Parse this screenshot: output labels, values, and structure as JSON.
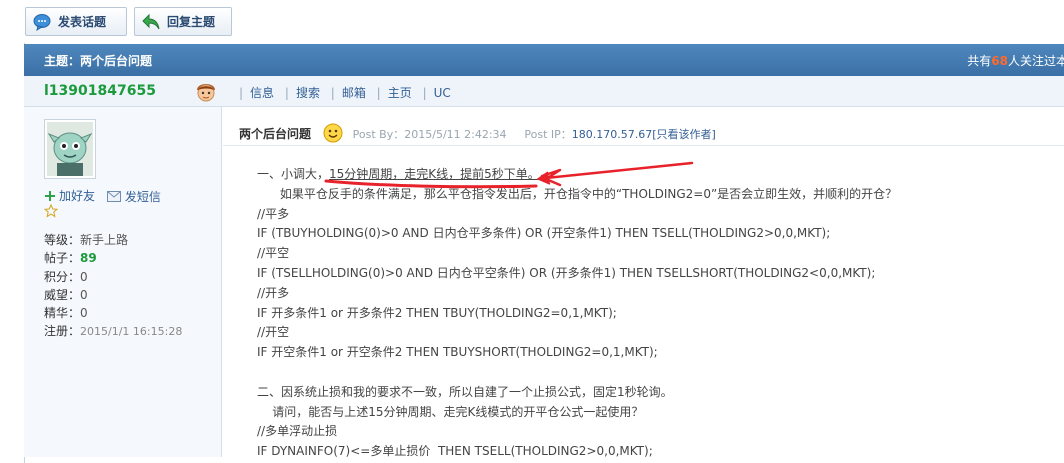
{
  "toolbar": {
    "post_label": "发表话题",
    "reply_label": "回复主题"
  },
  "topic": {
    "title": "主题：两个后台问题",
    "followers_prefix": "共有",
    "followers_count": "68",
    "followers_suffix": "人关注过本"
  },
  "user": {
    "name": "l13901847655",
    "nav": [
      "信息",
      "搜索",
      "邮箱",
      "主页",
      "UC"
    ],
    "add_friend": "加好友",
    "send_msg": "发短信",
    "stats": [
      {
        "k": "等级：",
        "v": "新手上路"
      },
      {
        "k": "帖子：",
        "v": "89"
      },
      {
        "k": "积分：",
        "v": "0"
      },
      {
        "k": "威望：",
        "v": "0"
      },
      {
        "k": "精华：",
        "v": "0"
      },
      {
        "k": "注册：",
        "v": "2015/1/1 16:15:28"
      }
    ]
  },
  "post": {
    "title": "两个后台问题",
    "posted_by": "Post By：2015/5/11 2:42:34",
    "ip_label": "Post IP：",
    "ip": "180.170.57.67",
    "author_only": "[只看该作者]",
    "lines": [
      {
        "pre": "一、小调大，",
        "ul": "15分钟周期，走完K线，提前5秒下单。",
        "post": ""
      },
      {
        "pre": "      如果平仓反手的条件满足，那么平仓指令发出后，开仓指令中的“THOLDING2=0”是否会立即生效，并顺利的开仓？"
      },
      {
        "pre": "//平多"
      },
      {
        "pre": "IF (TBUYHOLDING(0)>0 AND 日内仓平多条件) OR (开空条件1) THEN TSELL(THOLDING2>0,0,MKT);"
      },
      {
        "pre": "//平空"
      },
      {
        "pre": "IF (TSELLHOLDING(0)>0 AND 日内仓平空条件) OR (开多条件1) THEN TSELLSHORT(THOLDING2<0,0,MKT);"
      },
      {
        "pre": "//开多"
      },
      {
        "pre": "IF 开多条件1 or 开多条件2 THEN TBUY(THOLDING2=0,1,MKT);"
      },
      {
        "pre": "//开空"
      },
      {
        "pre": "IF 开空条件1 or 开空条件2 THEN TBUYSHORT(THOLDING2=0,1,MKT);"
      },
      {
        "pre": ""
      },
      {
        "pre": "二、因系统止损和我的要求不一致，所以自建了一个止损公式，固定1秒轮询。"
      },
      {
        "pre": "    请问，能否与上述15分钟周期、走完K线模式的开平仓公式一起使用？"
      },
      {
        "pre": "//多单浮动止损"
      },
      {
        "pre": "IF DYNAINFO(7)<=多单止损价  THEN TSELL(THOLDING2>0,0,MKT);"
      }
    ]
  },
  "colors": {
    "titlebar": "#3f78af",
    "username": "#1b9b3b",
    "annotation": "#e8222a",
    "link": "#335f95"
  }
}
